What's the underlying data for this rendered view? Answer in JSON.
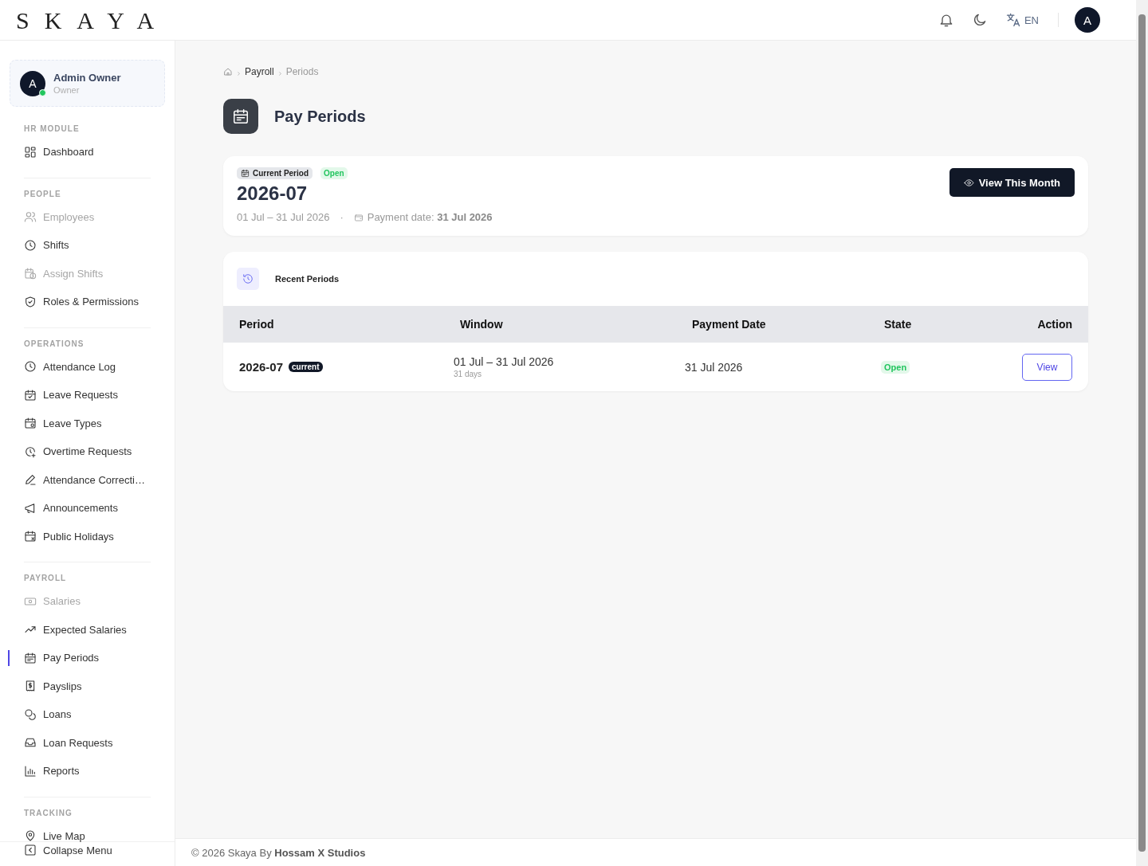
{
  "header": {
    "logo": "SKAYA",
    "language": "EN",
    "avatar": "A"
  },
  "sidebar": {
    "user": {
      "initial": "A",
      "name": "Admin Owner",
      "role": "Owner",
      "online": true
    },
    "sections": [
      {
        "title": "HR MODULE",
        "items": [
          {
            "label": "Dashboard",
            "disabled": false,
            "selected": false
          }
        ]
      },
      {
        "title": "PEOPLE",
        "items": [
          {
            "label": "Employees",
            "disabled": true,
            "selected": false
          },
          {
            "label": "Shifts",
            "disabled": false,
            "selected": false
          },
          {
            "label": "Assign Shifts",
            "disabled": true,
            "selected": false
          },
          {
            "label": "Roles & Permissions",
            "disabled": false,
            "selected": false
          }
        ]
      },
      {
        "title": "OPERATIONS",
        "items": [
          {
            "label": "Attendance Log",
            "disabled": false,
            "selected": false
          },
          {
            "label": "Leave Requests",
            "disabled": false,
            "selected": false
          },
          {
            "label": "Leave Types",
            "disabled": false,
            "selected": false
          },
          {
            "label": "Overtime Requests",
            "disabled": false,
            "selected": false
          },
          {
            "label": "Attendance Correcti…",
            "disabled": false,
            "selected": false
          },
          {
            "label": "Announcements",
            "disabled": false,
            "selected": false
          },
          {
            "label": "Public Holidays",
            "disabled": false,
            "selected": false
          }
        ]
      },
      {
        "title": "PAYROLL",
        "items": [
          {
            "label": "Salaries",
            "disabled": true,
            "selected": false
          },
          {
            "label": "Expected Salaries",
            "disabled": false,
            "selected": false
          },
          {
            "label": "Pay Periods",
            "disabled": false,
            "selected": true
          },
          {
            "label": "Payslips",
            "disabled": false,
            "selected": false
          },
          {
            "label": "Loans",
            "disabled": false,
            "selected": false
          },
          {
            "label": "Loan Requests",
            "disabled": false,
            "selected": false
          },
          {
            "label": "Reports",
            "disabled": false,
            "selected": false
          }
        ]
      },
      {
        "title": "TRACKING",
        "items": [
          {
            "label": "Live Map",
            "disabled": false,
            "selected": false
          }
        ]
      }
    ],
    "collapse": "Collapse Menu"
  },
  "breadcrumb": [
    "Payroll",
    "Periods"
  ],
  "page_title": "Pay Periods",
  "current_period": {
    "tag": "Current Period",
    "status": "Open",
    "period": "2026-07",
    "range": "01 Jul – 31 Jul 2026",
    "separator": "·",
    "payment": "Payment date: **31 Jul 2026**",
    "button": "View This Month"
  },
  "recent": {
    "title": "Recent Periods",
    "table": {
      "columns": [
        "Period",
        "Window",
        "Payment Date",
        "State",
        "Action"
      ],
      "rows": [
        {
          "period": "2026-07",
          "badge": "current",
          "window": "01 Jul – 31 Jul 2026",
          "days": "31 days",
          "payment_date": "31 Jul 2026",
          "state": "Open",
          "action": "View"
        }
      ]
    }
  },
  "footer": "© 2026 Skaya By **Hossam X Studios**"
}
